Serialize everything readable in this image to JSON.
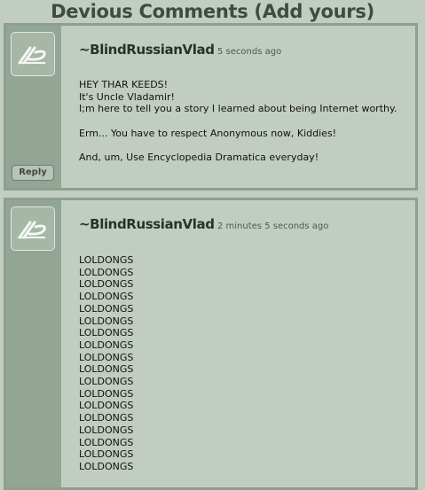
{
  "header": {
    "title": "Devious Comments (Add yours)"
  },
  "comments": [
    {
      "author": "~BlindRussianVlad",
      "time": "5 seconds ago",
      "paragraphs": [
        "HEY THAR KEEDS!\nIt's Uncle Vladamir!\nI;m here to tell you a story I learned about being Internet worthy.",
        "Erm... You have to respect Anonymous now, Kiddies!",
        "And, um, Use Encyclopedia Dramatica everyday!"
      ],
      "reply_label": "Reply",
      "avatar_icon": "deviantart-logo-icon"
    },
    {
      "author": "~BlindRussianVlad",
      "time": "2 minutes 5 seconds ago",
      "lines": [
        "LOLDONGS",
        "LOLDONGS",
        "LOLDONGS",
        "LOLDONGS",
        "LOLDONGS",
        "LOLDONGS",
        "LOLDONGS",
        "LOLDONGS",
        "LOLDONGS",
        "LOLDONGS",
        "LOLDONGS",
        "LOLDONGS",
        "LOLDONGS",
        "LOLDONGS",
        "LOLDONGS",
        "LOLDONGS",
        "LOLDONGS",
        "LOLDONGS"
      ],
      "avatar_icon": "deviantart-logo-icon"
    }
  ]
}
